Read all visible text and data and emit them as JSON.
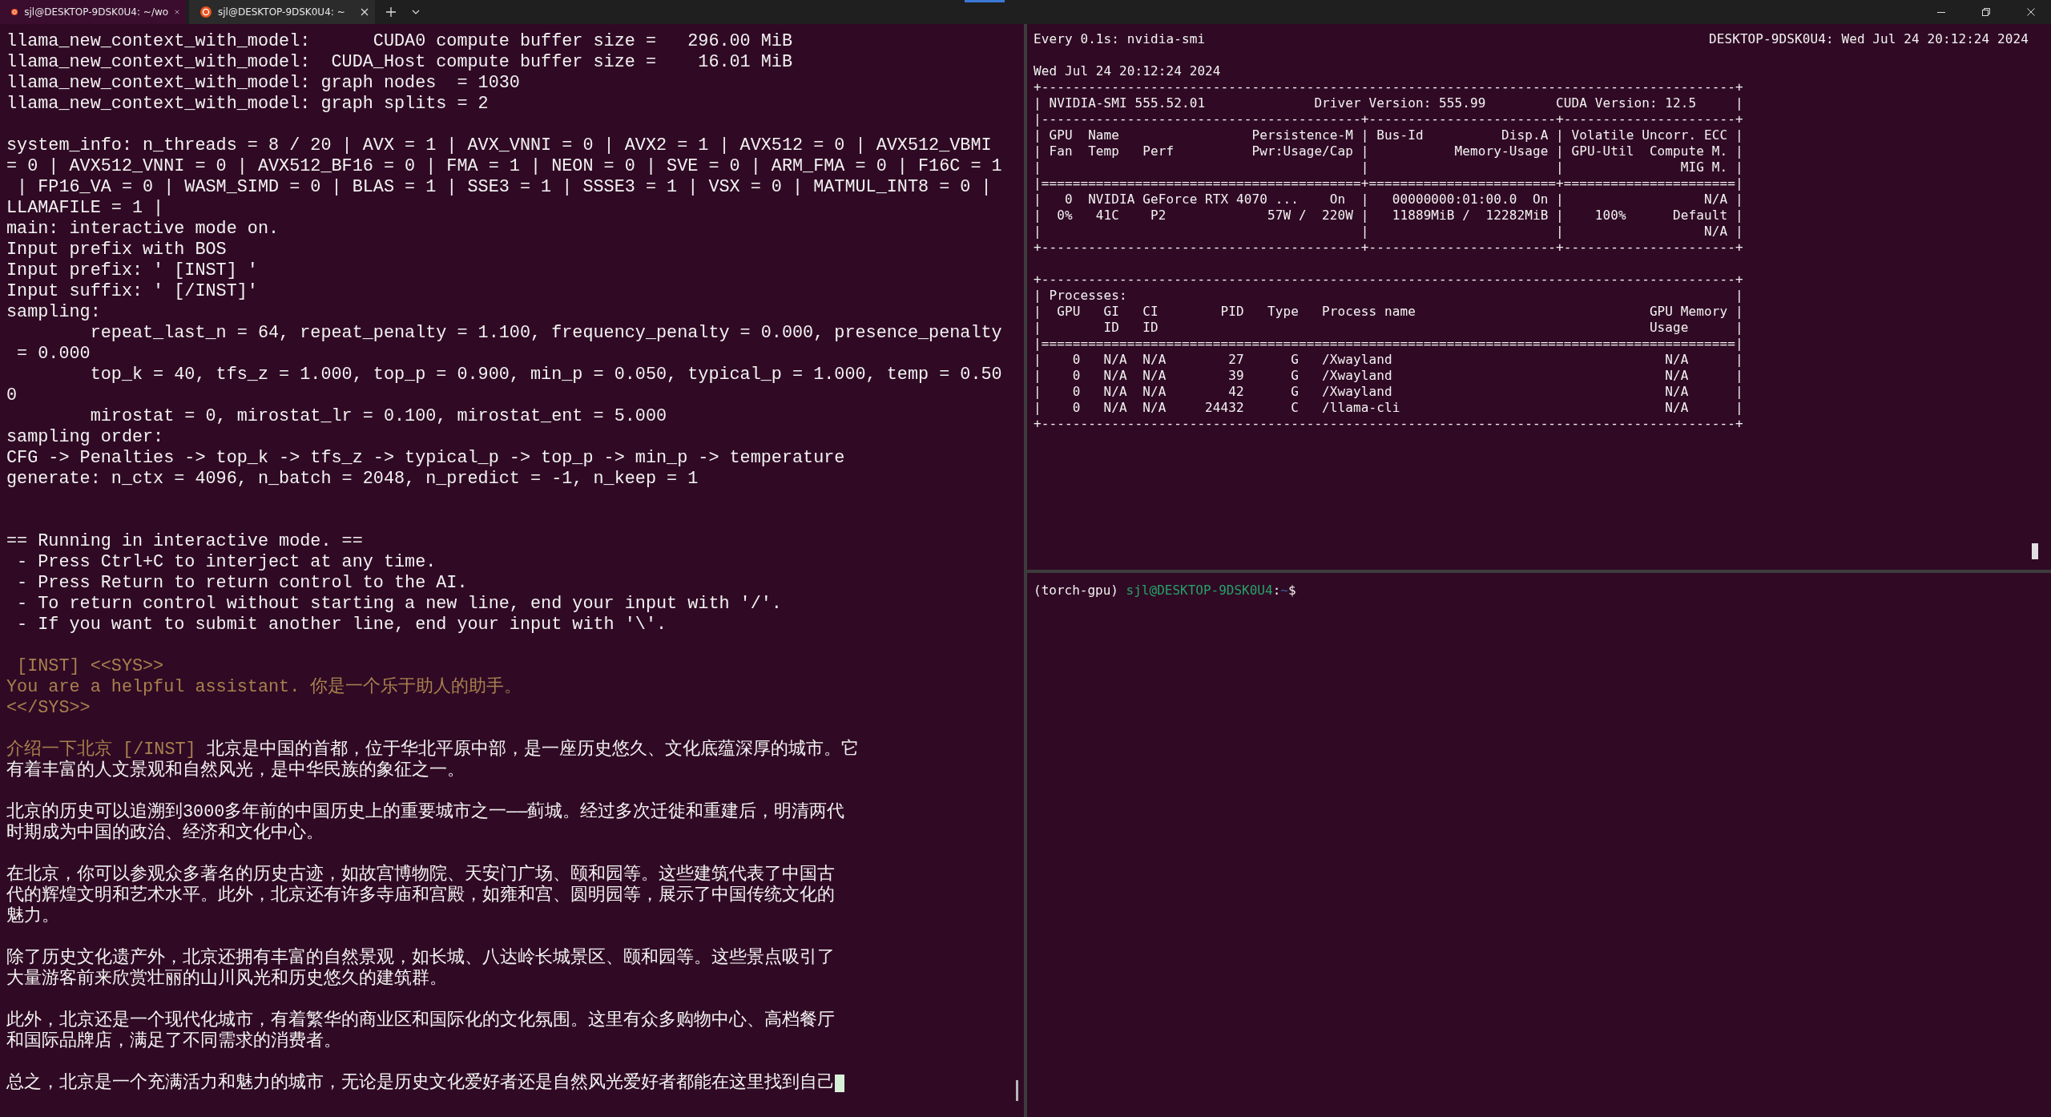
{
  "tabs": [
    {
      "title": "sjl@DESKTOP-9DSK0U4: ~/wo",
      "selected": true
    },
    {
      "title": "sjl@DESKTOP-9DSK0U4: ~",
      "selected": false
    }
  ],
  "left_pane": {
    "lines": [
      {
        "kind": "text",
        "segments": [
          {
            "text": "llama_new_context_with_model:      CUDA0 compute buffer size =   296.00 MiB",
            "kind": "output"
          }
        ]
      },
      {
        "kind": "text",
        "segments": [
          {
            "text": "llama_new_context_with_model:  CUDA_Host compute buffer size =    16.01 MiB",
            "kind": "output"
          }
        ]
      },
      {
        "kind": "text",
        "segments": [
          {
            "text": "llama_new_context_with_model: graph nodes  = 1030",
            "kind": "output"
          }
        ]
      },
      {
        "kind": "text",
        "segments": [
          {
            "text": "llama_new_context_with_model: graph splits = 2",
            "kind": "output"
          }
        ]
      },
      {
        "kind": "blank"
      },
      {
        "kind": "text",
        "segments": [
          {
            "text": "system_info: n_threads = 8 / 20 | AVX = 1 | AVX_VNNI = 0 | AVX2 = 1 | AVX512 = 0 | AVX512_VBMI",
            "kind": "output"
          }
        ]
      },
      {
        "kind": "text",
        "segments": [
          {
            "text": "= 0 | AVX512_VNNI = 0 | AVX512_BF16 = 0 | FMA = 1 | NEON = 0 | SVE = 0 | ARM_FMA = 0 | F16C = 1",
            "kind": "output"
          }
        ]
      },
      {
        "kind": "text",
        "segments": [
          {
            "text": " | FP16_VA = 0 | WASM_SIMD = 0 | BLAS = 1 | SSE3 = 1 | SSSE3 = 1 | VSX = 0 | MATMUL_INT8 = 0 |",
            "kind": "output"
          }
        ]
      },
      {
        "kind": "text",
        "segments": [
          {
            "text": "LLAMAFILE = 1 |",
            "kind": "output"
          }
        ]
      },
      {
        "kind": "text",
        "segments": [
          {
            "text": "main: interactive mode on.",
            "kind": "output"
          }
        ]
      },
      {
        "kind": "text",
        "segments": [
          {
            "text": "Input prefix with BOS",
            "kind": "output"
          }
        ]
      },
      {
        "kind": "text",
        "segments": [
          {
            "text": "Input prefix: ' [INST] '",
            "kind": "output"
          }
        ]
      },
      {
        "kind": "text",
        "segments": [
          {
            "text": "Input suffix: ' [/INST]'",
            "kind": "output"
          }
        ]
      },
      {
        "kind": "text",
        "segments": [
          {
            "text": "sampling:",
            "kind": "output"
          }
        ]
      },
      {
        "kind": "text",
        "segments": [
          {
            "text": "        repeat_last_n = 64, repeat_penalty = 1.100, frequency_penalty = 0.000, presence_penalty",
            "kind": "output"
          }
        ]
      },
      {
        "kind": "text",
        "segments": [
          {
            "text": " = 0.000",
            "kind": "output"
          }
        ]
      },
      {
        "kind": "text",
        "segments": [
          {
            "text": "        top_k = 40, tfs_z = 1.000, top_p = 0.900, min_p = 0.050, typical_p = 1.000, temp = 0.50",
            "kind": "output"
          }
        ]
      },
      {
        "kind": "text",
        "segments": [
          {
            "text": "0",
            "kind": "output"
          }
        ]
      },
      {
        "kind": "text",
        "segments": [
          {
            "text": "        mirostat = 0, mirostat_lr = 0.100, mirostat_ent = 5.000",
            "kind": "output"
          }
        ]
      },
      {
        "kind": "text",
        "segments": [
          {
            "text": "sampling order:",
            "kind": "output"
          }
        ]
      },
      {
        "kind": "text",
        "segments": [
          {
            "text": "CFG -> Penalties -> top_k -> tfs_z -> typical_p -> top_p -> min_p -> temperature",
            "kind": "output"
          }
        ]
      },
      {
        "kind": "text",
        "segments": [
          {
            "text": "generate: n_ctx = 4096, n_batch = 2048, n_predict = -1, n_keep = 1",
            "kind": "output"
          }
        ]
      },
      {
        "kind": "blank"
      },
      {
        "kind": "blank"
      },
      {
        "kind": "text",
        "segments": [
          {
            "text": "== Running in interactive mode. ==",
            "kind": "output"
          }
        ]
      },
      {
        "kind": "text",
        "segments": [
          {
            "text": " - Press Ctrl+C to interject at any time.",
            "kind": "output"
          }
        ]
      },
      {
        "kind": "text",
        "segments": [
          {
            "text": " - Press Return to return control to the AI.",
            "kind": "output"
          }
        ]
      },
      {
        "kind": "text",
        "segments": [
          {
            "text": " - To return control without starting a new line, end your input with '/'.",
            "kind": "output"
          }
        ]
      },
      {
        "kind": "text",
        "segments": [
          {
            "text": " - If you want to submit another line, end your input with '\\'.",
            "kind": "output"
          }
        ]
      },
      {
        "kind": "blank"
      },
      {
        "kind": "text",
        "segments": [
          {
            "text": " [INST] <<SYS>>",
            "kind": "prompt"
          }
        ]
      },
      {
        "kind": "text",
        "segments": [
          {
            "text": "You are a helpful assistant. 你是一个乐于助人的助手。",
            "kind": "prompt"
          }
        ]
      },
      {
        "kind": "text",
        "segments": [
          {
            "text": "<</SYS>>",
            "kind": "prompt"
          }
        ]
      },
      {
        "kind": "blank"
      },
      {
        "kind": "text",
        "segments": [
          {
            "text": "介绍一下北京 [/INST]",
            "kind": "prompt"
          },
          {
            "text": " 北京是中国的首都，位于华北平原中部，是一座历史悠久、文化底蕴深厚的城市。它",
            "kind": "output"
          }
        ]
      },
      {
        "kind": "text",
        "segments": [
          {
            "text": "有着丰富的人文景观和自然风光，是中华民族的象征之一。",
            "kind": "output"
          }
        ]
      },
      {
        "kind": "blank"
      },
      {
        "kind": "text",
        "segments": [
          {
            "text": "北京的历史可以追溯到3000多年前的中国历史上的重要城市之一——蓟城。经过多次迁徙和重建后，明清两代",
            "kind": "output"
          }
        ]
      },
      {
        "kind": "text",
        "segments": [
          {
            "text": "时期成为中国的政治、经济和文化中心。",
            "kind": "output"
          }
        ]
      },
      {
        "kind": "blank"
      },
      {
        "kind": "text",
        "segments": [
          {
            "text": "在北京，你可以参观众多著名的历史古迹，如故宫博物院、天安门广场、颐和园等。这些建筑代表了中国古",
            "kind": "output"
          }
        ]
      },
      {
        "kind": "text",
        "segments": [
          {
            "text": "代的辉煌文明和艺术水平。此外，北京还有许多寺庙和宫殿，如雍和宫、圆明园等，展示了中国传统文化的",
            "kind": "output"
          }
        ]
      },
      {
        "kind": "text",
        "segments": [
          {
            "text": "魅力。",
            "kind": "output"
          }
        ]
      },
      {
        "kind": "blank"
      },
      {
        "kind": "text",
        "segments": [
          {
            "text": "除了历史文化遗产外，北京还拥有丰富的自然景观，如长城、八达岭长城景区、颐和园等。这些景点吸引了",
            "kind": "output"
          }
        ]
      },
      {
        "kind": "text",
        "segments": [
          {
            "text": "大量游客前来欣赏壮丽的山川风光和历史悠久的建筑群。",
            "kind": "output"
          }
        ]
      },
      {
        "kind": "blank"
      },
      {
        "kind": "text",
        "segments": [
          {
            "text": "此外，北京还是一个现代化城市，有着繁华的商业区和国际化的文化氛围。这里有众多购物中心、高档餐厅",
            "kind": "output"
          }
        ]
      },
      {
        "kind": "text",
        "segments": [
          {
            "text": "和国际品牌店，满足了不同需求的消费者。",
            "kind": "output"
          }
        ]
      },
      {
        "kind": "blank"
      },
      {
        "kind": "text",
        "cursor": true,
        "segments": [
          {
            "text": "总之，北京是一个充满活力和魅力的城市，无论是历史文化爱好者还是自然风光爱好者都能在这里找到自己",
            "kind": "output"
          }
        ]
      }
    ]
  },
  "watch_pane": {
    "header_left": "Every 0.1s: nvidia-smi",
    "header_right": "DESKTOP-9DSK0U4: Wed Jul 24 20:12:24 2024",
    "lines": [
      {
        "kind": "text",
        "text": "Wed Jul 24 20:12:24 2024"
      },
      {
        "kind": "text",
        "text": "+-----------------------------------------------------------------------------------------+"
      },
      {
        "kind": "text",
        "text": "| NVIDIA-SMI 555.52.01              Driver Version: 555.99         CUDA Version: 12.5     |"
      },
      {
        "kind": "text",
        "text": "|-----------------------------------------+------------------------+----------------------+"
      },
      {
        "kind": "text",
        "text": "| GPU  Name                 Persistence-M | Bus-Id          Disp.A | Volatile Uncorr. ECC |"
      },
      {
        "kind": "text",
        "text": "| Fan  Temp   Perf          Pwr:Usage/Cap |           Memory-Usage | GPU-Util  Compute M. |"
      },
      {
        "kind": "text",
        "text": "|                                         |                        |               MIG M. |"
      },
      {
        "kind": "text",
        "text": "|=========================================+========================+======================|"
      },
      {
        "kind": "text",
        "text": "|   0  NVIDIA GeForce RTX 4070 ...    On  |   00000000:01:00.0  On |                  N/A |"
      },
      {
        "kind": "text",
        "text": "|  0%   41C    P2             57W /  220W |   11889MiB /  12282MiB |    100%      Default |"
      },
      {
        "kind": "text",
        "text": "|                                         |                        |                  N/A |"
      },
      {
        "kind": "text",
        "text": "+-----------------------------------------+------------------------+----------------------+"
      },
      {
        "kind": "blank"
      },
      {
        "kind": "text",
        "text": "+-----------------------------------------------------------------------------------------+"
      },
      {
        "kind": "text",
        "text": "| Processes:                                                                              |"
      },
      {
        "kind": "text",
        "text": "|  GPU   GI   CI        PID   Type   Process name                              GPU Memory |"
      },
      {
        "kind": "text",
        "text": "|        ID   ID                                                               Usage      |"
      },
      {
        "kind": "text",
        "text": "|=========================================================================================|"
      },
      {
        "kind": "text",
        "text": "|    0   N/A  N/A        27      G   /Xwayland                                   N/A      |"
      },
      {
        "kind": "text",
        "text": "|    0   N/A  N/A        39      G   /Xwayland                                   N/A      |"
      },
      {
        "kind": "text",
        "text": "|    0   N/A  N/A        42      G   /Xwayland                                   N/A      |"
      },
      {
        "kind": "text",
        "text": "|    0   N/A  N/A     24432      C   /llama-cli                                  N/A      |"
      },
      {
        "kind": "text",
        "text": "+-----------------------------------------------------------------------------------------+"
      }
    ]
  },
  "shell_pane": {
    "prompt": [
      {
        "text": "(torch-gpu) ",
        "kind": "plain"
      },
      {
        "text": "sjl@DESKTOP-9DSK0U4",
        "kind": "user"
      },
      {
        "text": ":",
        "kind": "plain"
      },
      {
        "text": "~",
        "kind": "path"
      },
      {
        "text": "$",
        "kind": "plain"
      }
    ]
  }
}
